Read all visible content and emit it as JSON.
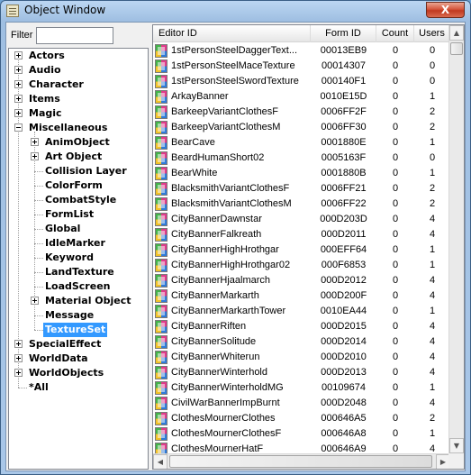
{
  "window": {
    "title": "Object Window",
    "close_glyph": "X"
  },
  "filter": {
    "label": "Filter",
    "value": ""
  },
  "tree": {
    "items": [
      {
        "label": "Actors",
        "level": 0,
        "expander": "plus"
      },
      {
        "label": "Audio",
        "level": 0,
        "expander": "plus"
      },
      {
        "label": "Character",
        "level": 0,
        "expander": "plus"
      },
      {
        "label": "Items",
        "level": 0,
        "expander": "plus"
      },
      {
        "label": "Magic",
        "level": 0,
        "expander": "plus"
      },
      {
        "label": "Miscellaneous",
        "level": 0,
        "expander": "minus"
      },
      {
        "label": "AnimObject",
        "level": 1,
        "expander": "plus"
      },
      {
        "label": "Art Object",
        "level": 1,
        "expander": "plus"
      },
      {
        "label": "Collision Layer",
        "level": 1,
        "expander": "none"
      },
      {
        "label": "ColorForm",
        "level": 1,
        "expander": "none"
      },
      {
        "label": "CombatStyle",
        "level": 1,
        "expander": "none"
      },
      {
        "label": "FormList",
        "level": 1,
        "expander": "none"
      },
      {
        "label": "Global",
        "level": 1,
        "expander": "none"
      },
      {
        "label": "IdleMarker",
        "level": 1,
        "expander": "none"
      },
      {
        "label": "Keyword",
        "level": 1,
        "expander": "none"
      },
      {
        "label": "LandTexture",
        "level": 1,
        "expander": "none"
      },
      {
        "label": "LoadScreen",
        "level": 1,
        "expander": "none"
      },
      {
        "label": "Material Object",
        "level": 1,
        "expander": "plus"
      },
      {
        "label": "Message",
        "level": 1,
        "expander": "none"
      },
      {
        "label": "TextureSet",
        "level": 1,
        "expander": "none",
        "selected": true
      },
      {
        "label": "SpecialEffect",
        "level": 0,
        "expander": "plus"
      },
      {
        "label": "WorldData",
        "level": 0,
        "expander": "plus"
      },
      {
        "label": "WorldObjects",
        "level": 0,
        "expander": "plus"
      },
      {
        "label": "*All",
        "level": 0,
        "expander": "none"
      }
    ]
  },
  "list": {
    "columns": [
      "Editor ID",
      "Form ID",
      "Count",
      "Users"
    ],
    "rows": [
      [
        "1stPersonSteelDaggerText...",
        "00013EB9",
        "0",
        "0"
      ],
      [
        "1stPersonSteelMaceTexture",
        "00014307",
        "0",
        "0"
      ],
      [
        "1stPersonSteelSwordTexture",
        "000140F1",
        "0",
        "0"
      ],
      [
        "ArkayBanner",
        "0010E15D",
        "0",
        "1"
      ],
      [
        "BarkeepVariantClothesF",
        "0006FF2F",
        "0",
        "2"
      ],
      [
        "BarkeepVariantClothesM",
        "0006FF30",
        "0",
        "2"
      ],
      [
        "BearCave",
        "0001880E",
        "0",
        "1"
      ],
      [
        "BeardHumanShort02",
        "0005163F",
        "0",
        "0"
      ],
      [
        "BearWhite",
        "0001880B",
        "0",
        "1"
      ],
      [
        "BlacksmithVariantClothesF",
        "0006FF21",
        "0",
        "2"
      ],
      [
        "BlacksmithVariantClothesM",
        "0006FF22",
        "0",
        "2"
      ],
      [
        "CityBannerDawnstar",
        "000D203D",
        "0",
        "4"
      ],
      [
        "CityBannerFalkreath",
        "000D2011",
        "0",
        "4"
      ],
      [
        "CityBannerHighHrothgar",
        "000EFF64",
        "0",
        "1"
      ],
      [
        "CityBannerHighHrothgar02",
        "000F6853",
        "0",
        "1"
      ],
      [
        "CityBannerHjaalmarch",
        "000D2012",
        "0",
        "4"
      ],
      [
        "CityBannerMarkarth",
        "000D200F",
        "0",
        "4"
      ],
      [
        "CityBannerMarkarthTower",
        "0010EA44",
        "0",
        "1"
      ],
      [
        "CityBannerRiften",
        "000D2015",
        "0",
        "4"
      ],
      [
        "CityBannerSolitude",
        "000D2014",
        "0",
        "4"
      ],
      [
        "CityBannerWhiterun",
        "000D2010",
        "0",
        "4"
      ],
      [
        "CityBannerWinterhold",
        "000D2013",
        "0",
        "4"
      ],
      [
        "CityBannerWinterholdMG",
        "00109674",
        "0",
        "1"
      ],
      [
        "CivilWarBannerImpBurnt",
        "000D2048",
        "0",
        "4"
      ],
      [
        "ClothesMournerClothes",
        "000646A5",
        "0",
        "2"
      ],
      [
        "ClothesMournerClothesF",
        "000646A8",
        "0",
        "1"
      ],
      [
        "ClothesMournerHatF",
        "000646A9",
        "0",
        "4"
      ]
    ]
  },
  "scrollbars": {
    "up_glyph": "▲",
    "down_glyph": "▼",
    "left_glyph": "◀",
    "right_glyph": "▶"
  }
}
